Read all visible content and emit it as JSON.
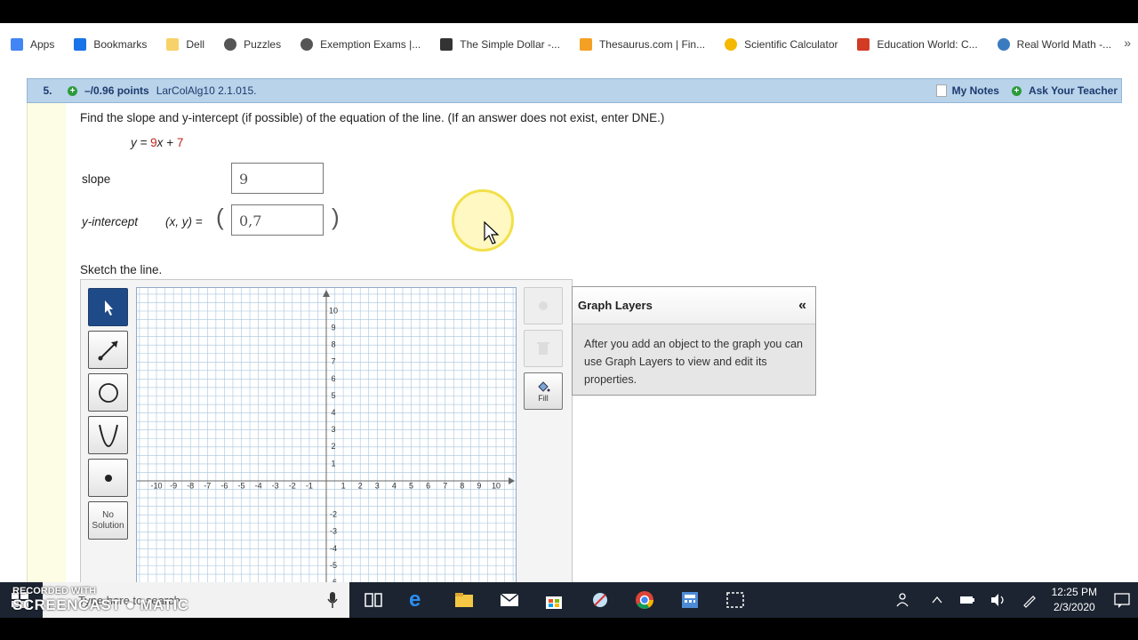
{
  "bookmarks": [
    {
      "label": "Apps",
      "icon": "apps-grid-icon",
      "color": "#4285f4"
    },
    {
      "label": "Bookmarks",
      "icon": "star-icon",
      "color": "#1a73e8"
    },
    {
      "label": "Dell",
      "icon": "folder-icon",
      "color": "#f7d26b"
    },
    {
      "label": "Puzzles",
      "icon": "globe-icon",
      "color": "#555555"
    },
    {
      "label": "Exemption Exams |...",
      "icon": "globe-icon",
      "color": "#555555"
    },
    {
      "label": "The Simple Dollar -...",
      "icon": "monitor-icon",
      "color": "#333333"
    },
    {
      "label": "Thesaurus.com | Fin...",
      "icon": "thesaurus-icon",
      "color": "#f4a024"
    },
    {
      "label": "Scientific Calculator",
      "icon": "calculator-icon",
      "color": "#f5b800"
    },
    {
      "label": "Education World: C...",
      "icon": "ew-icon",
      "color": "#d33b25"
    },
    {
      "label": "Real World Math -...",
      "icon": "earth-icon",
      "color": "#3a7bbf"
    }
  ],
  "question": {
    "number": "5.",
    "points": "–/0.96 points",
    "source": "LarColAlg10 2.1.015.",
    "my_notes": "My Notes",
    "ask_teacher": "Ask Your Teacher",
    "instruction": "Find the slope and y-intercept (if possible) of the equation of the line. (If an answer does not exist, enter DNE.)",
    "equation": {
      "lhs": "y =",
      "coef": "9",
      "var": "x",
      "op": "+",
      "const": "7"
    },
    "slope_label": "slope",
    "slope_value": "9",
    "yint_label": "y-intercept",
    "xy_label": "(x, y) =",
    "yint_value": "0,7",
    "sketch_label": "Sketch the line."
  },
  "graph": {
    "x_ticks": [
      "-10",
      "-9",
      "-8",
      "-7",
      "-6",
      "-5",
      "-4",
      "-3",
      "-2",
      "-1",
      "1",
      "2",
      "3",
      "4",
      "5",
      "6",
      "7",
      "8",
      "9",
      "10"
    ],
    "y_ticks": [
      "10",
      "9",
      "8",
      "7",
      "6",
      "5",
      "4",
      "3",
      "2",
      "1",
      "-2",
      "-3",
      "-4",
      "-5",
      "-6"
    ],
    "tools": [
      "pointer-tool",
      "line-tool",
      "circle-tool",
      "parabola-tool",
      "point-tool"
    ],
    "no_solution": "No Solution",
    "fill_label": "Fill",
    "grid_color": "#a6c4dc"
  },
  "layers": {
    "title": "Graph Layers",
    "collapse": "«",
    "body": "After you add an object to the graph you can use Graph Layers to view and edit its properties."
  },
  "taskbar": {
    "search_placeholder": "Type here to search",
    "time": "12:25 PM",
    "date": "2/3/2020"
  },
  "watermark": {
    "line1": "RECORDED WITH",
    "line2": "SCREENCAST ● MATIC"
  }
}
